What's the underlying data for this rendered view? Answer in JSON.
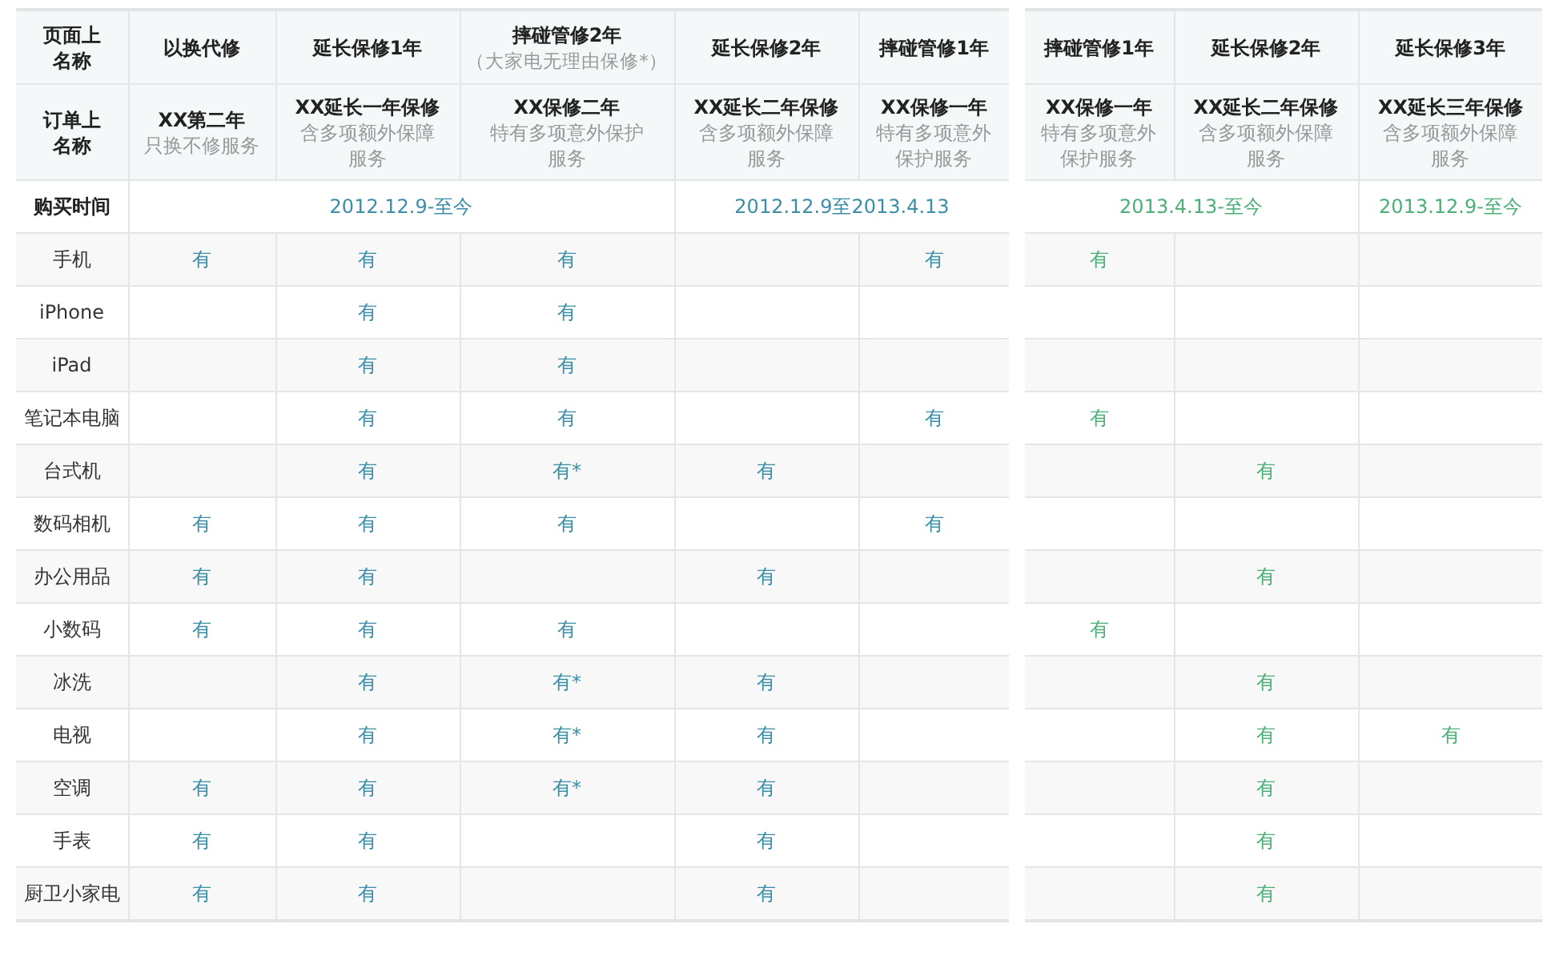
{
  "tables": [
    {
      "color": "#3a8ea8",
      "header_label": "页面上名称",
      "order_label": "订单上名称",
      "purchase_label": "购买时间",
      "columns": [
        {
          "title": "以换代修",
          "order_name": "XX第二年",
          "order_desc": "只换不修服务"
        },
        {
          "title": "延长保修1年",
          "order_name": "XX延长一年保修",
          "order_desc": "含多项额外保障服务"
        },
        {
          "title": "摔碰管修2年",
          "note": "（大家电无理由保修*）",
          "order_name": "XX保修二年",
          "order_desc": "特有多项意外保护服务"
        },
        {
          "title": "延长保修2年",
          "order_name": "XX延长二年保修",
          "order_desc": "含多项额外保障服务"
        },
        {
          "title": "摔碰管修1年",
          "order_name": "XX保修一年",
          "order_desc": "特有多项意外保护服务"
        }
      ],
      "periods": [
        {
          "text": "2012.12.9-至今"
        },
        {
          "text": "2012.12.9至2013.4.13"
        }
      ],
      "rows": [
        {
          "label": "手机",
          "cells": [
            "有",
            "有",
            "有",
            "",
            "有"
          ]
        },
        {
          "label": "iPhone",
          "cells": [
            "",
            "有",
            "有",
            "",
            ""
          ]
        },
        {
          "label": "iPad",
          "cells": [
            "",
            "有",
            "有",
            "",
            ""
          ]
        },
        {
          "label": "笔记本电脑",
          "cells": [
            "",
            "有",
            "有",
            "",
            "有"
          ]
        },
        {
          "label": "台式机",
          "cells": [
            "",
            "有",
            "有*",
            "有",
            ""
          ]
        },
        {
          "label": "数码相机",
          "cells": [
            "有",
            "有",
            "有",
            "",
            "有"
          ]
        },
        {
          "label": "办公用品",
          "cells": [
            "有",
            "有",
            "",
            "有",
            ""
          ]
        },
        {
          "label": "小数码",
          "cells": [
            "有",
            "有",
            "有",
            "",
            ""
          ]
        },
        {
          "label": "冰洗",
          "cells": [
            "",
            "有",
            "有*",
            "有",
            ""
          ]
        },
        {
          "label": "电视",
          "cells": [
            "",
            "有",
            "有*",
            "有",
            ""
          ]
        },
        {
          "label": "空调",
          "cells": [
            "有",
            "有",
            "有*",
            "有",
            ""
          ]
        },
        {
          "label": "手表",
          "cells": [
            "有",
            "有",
            "",
            "有",
            ""
          ]
        },
        {
          "label": "厨卫小家电",
          "cells": [
            "有",
            "有",
            "",
            "有",
            ""
          ]
        }
      ]
    },
    {
      "color": "#4caf78",
      "columns": [
        {
          "title": "摔碰管修1年",
          "order_name": "XX保修一年",
          "order_desc": "特有多项意外保护服务"
        },
        {
          "title": "延长保修2年",
          "order_name": "XX延长二年保修",
          "order_desc": "含多项额外保障服务"
        },
        {
          "title": "延长保修3年",
          "order_name": "XX延长三年保修",
          "order_desc": "含多项额外保障服务"
        }
      ],
      "periods": [
        {
          "text": "2013.4.13-至今"
        },
        {
          "text": "2013.12.9-至今"
        }
      ],
      "rows": [
        {
          "cells": [
            "有",
            "",
            ""
          ]
        },
        {
          "cells": [
            "",
            "",
            ""
          ]
        },
        {
          "cells": [
            "",
            "",
            ""
          ]
        },
        {
          "cells": [
            "有",
            "",
            ""
          ]
        },
        {
          "cells": [
            "",
            "有",
            ""
          ]
        },
        {
          "cells": [
            "",
            "",
            ""
          ]
        },
        {
          "cells": [
            "",
            "有",
            ""
          ]
        },
        {
          "cells": [
            "有",
            "",
            ""
          ]
        },
        {
          "cells": [
            "",
            "有",
            ""
          ]
        },
        {
          "cells": [
            "",
            "有",
            "有"
          ]
        },
        {
          "cells": [
            "",
            "有",
            ""
          ]
        },
        {
          "cells": [
            "",
            "有",
            ""
          ]
        },
        {
          "cells": [
            "",
            "有",
            ""
          ]
        }
      ]
    }
  ]
}
